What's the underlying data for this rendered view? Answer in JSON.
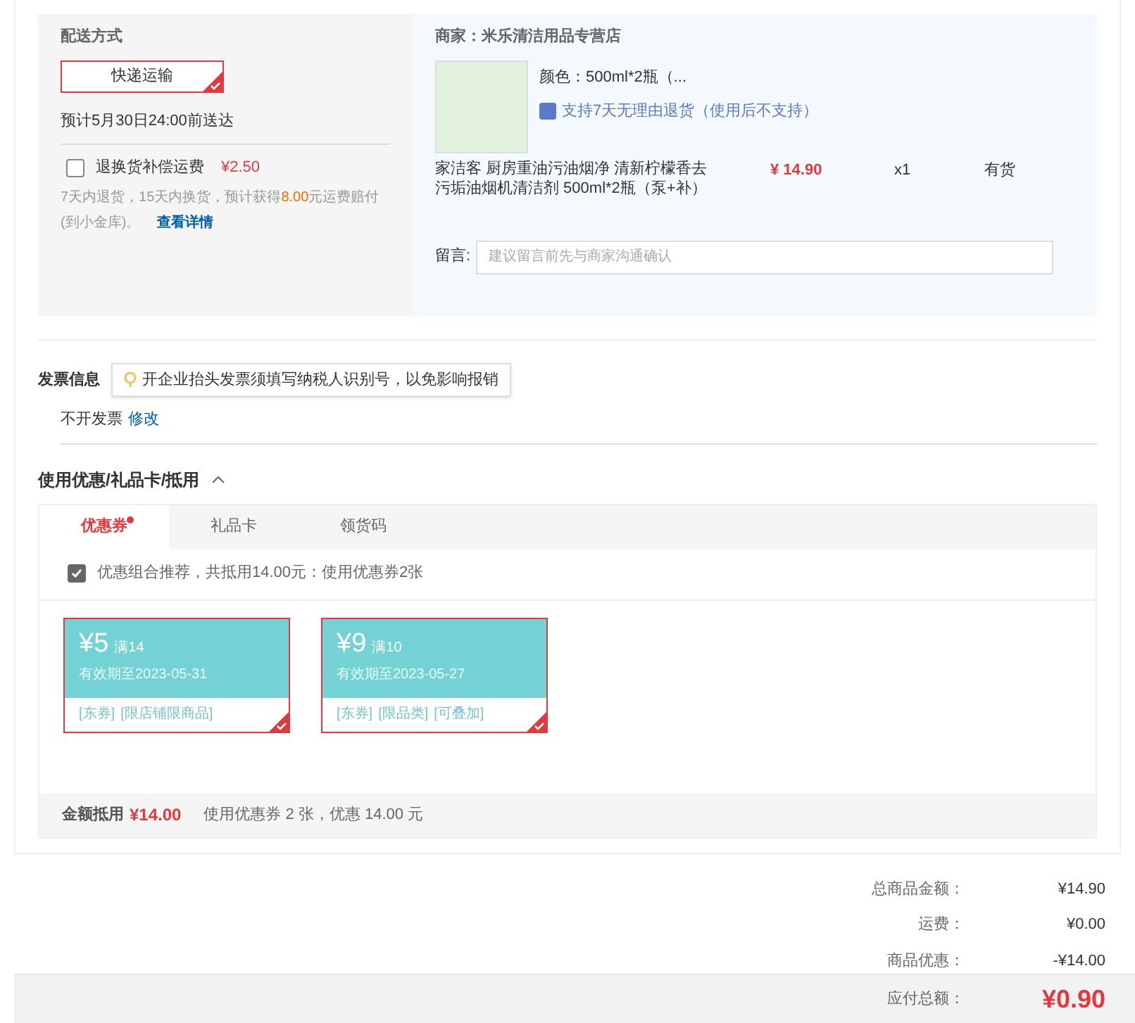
{
  "shipping": {
    "title": "配送方式",
    "method": {
      "label": "快递运输",
      "selected": true
    },
    "eta": "预计5月30日24:00前送达",
    "insurance": {
      "label": "退换货补偿运费",
      "price": "¥2.50",
      "checked": false
    },
    "insurance_note": "7天内退货，15天内换货，预计获得**8.00**元运费赔付(到小金库)。",
    "details_link": "查看详情"
  },
  "store": {
    "seller": "商家：米乐清洁用品专营店",
    "color_option": "颜色：500ml*2瓶（...",
    "return_policy": "支持7天无理由退货（使用后不支持）",
    "product_name": "家洁客 厨房重油污油烟净 清新柠檬香去污垢油烟机清洁剂 500ml*2瓶（泵+补）",
    "price": "¥ 14.90",
    "quantity": "x1",
    "stock": "有货",
    "message_label": "留言:",
    "message_placeholder": "建议留言前先与商家沟通确认"
  },
  "invoice": {
    "title": "发票信息",
    "tip": "开企业抬头发票须填写纳税人识别号，以免影响报销",
    "value": "不开发票",
    "edit_link": "修改"
  },
  "discounts": {
    "title": "使用优惠/礼品卡/抵用",
    "expanded": true,
    "tabs": [
      {
        "label": "优惠券",
        "selected": true,
        "dot": true
      },
      {
        "label": "礼品卡",
        "selected": false,
        "dot": false
      },
      {
        "label": "领货码",
        "selected": false,
        "dot": false
      }
    ],
    "recommend": {
      "label": "优惠组合推荐，共抵用14.00元：使用优惠券2张",
      "checked": true
    },
    "coupons": [
      {
        "amount": "¥5",
        "threshold": "满14",
        "validity": "有效期至2023-05-31",
        "tags": [
          "[东券]",
          "[限店铺限商品]"
        ],
        "selected": true
      },
      {
        "amount": "¥9",
        "threshold": "满10",
        "validity": "有效期至2023-05-27",
        "tags": [
          "[东券]",
          "[限品类]",
          "[可叠加]"
        ],
        "selected": true
      }
    ],
    "summary_label": "金额抵用",
    "summary_amount": "¥14.00",
    "summary_note": "使用优惠券 2 张，优惠 14.00 元"
  },
  "totals": [
    {
      "label": "总商品金额：",
      "value": "¥14.90"
    },
    {
      "label": "运费：",
      "value": "¥0.00"
    },
    {
      "label": "商品优惠：",
      "value": "-¥14.00"
    }
  ],
  "payable": {
    "label": "应付总额：",
    "value": "¥0.90"
  }
}
